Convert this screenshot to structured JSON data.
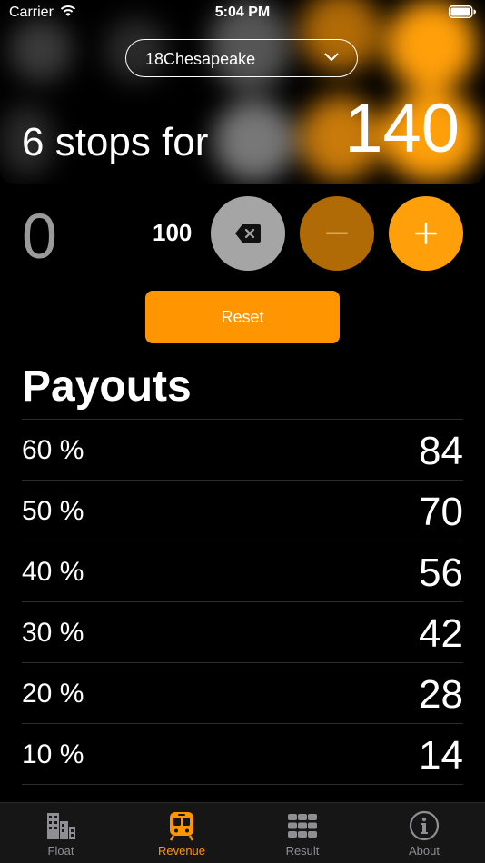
{
  "status_bar": {
    "carrier": "Carrier",
    "time": "5:04 PM"
  },
  "selector": {
    "value": "18Chesapeake"
  },
  "summary": {
    "stops_label": "6 stops for",
    "total": "140"
  },
  "keypad": {
    "input_value": "0",
    "step_value": "100"
  },
  "reset_label": "Reset",
  "payouts": {
    "title": "Payouts",
    "rows": [
      {
        "percent": "60 %",
        "amount": "84"
      },
      {
        "percent": "50 %",
        "amount": "70"
      },
      {
        "percent": "40 %",
        "amount": "56"
      },
      {
        "percent": "30 %",
        "amount": "42"
      },
      {
        "percent": "20 %",
        "amount": "28"
      },
      {
        "percent": "10 %",
        "amount": "14"
      }
    ]
  },
  "tabs": [
    {
      "label": "Float",
      "icon": "buildings-icon"
    },
    {
      "label": "Revenue",
      "icon": "train-icon",
      "active": true
    },
    {
      "label": "Result",
      "icon": "grid-icon"
    },
    {
      "label": "About",
      "icon": "info-icon"
    }
  ],
  "colors": {
    "accent": "#ff9500",
    "minus": "#b06a06",
    "delete": "#a5a5a5",
    "background": "#000000"
  }
}
